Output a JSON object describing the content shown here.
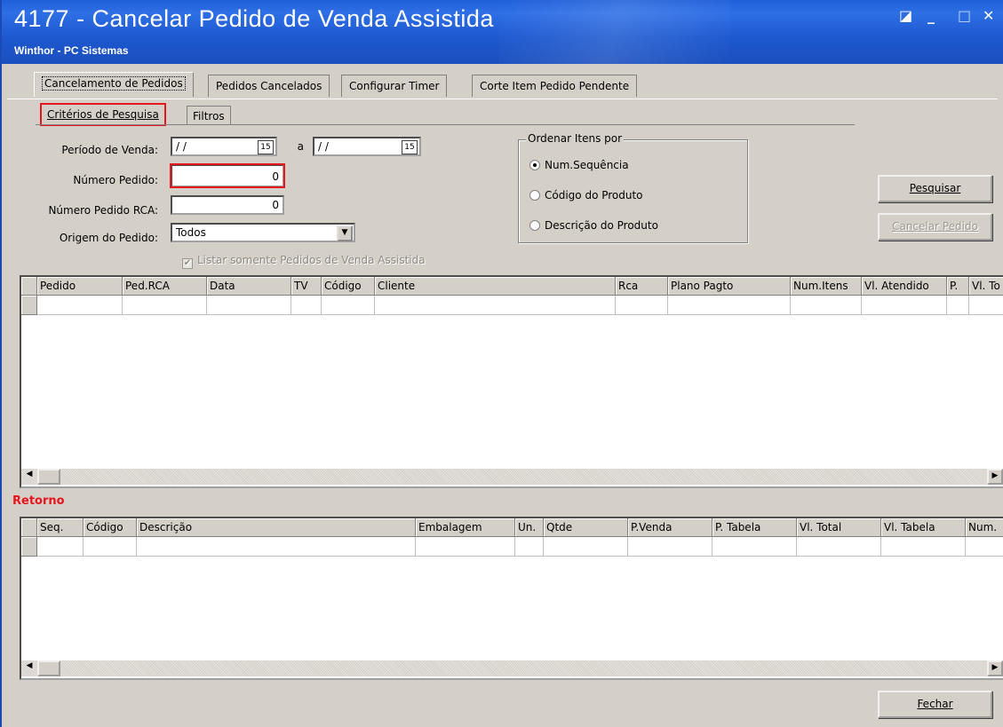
{
  "window": {
    "title": "4177 - Cancelar Pedido de Venda Assistida",
    "subtitle": "Winthor - PC Sistemas",
    "controls": {
      "restore": "◪",
      "minimize": "_",
      "maximize": "□",
      "close": "✕"
    }
  },
  "main_tabs": [
    {
      "label": "Cancelamento de Pedidos",
      "active": true
    },
    {
      "label": "Pedidos Cancelados",
      "active": false
    },
    {
      "label": "Configurar Timer",
      "active": false
    },
    {
      "label": "Corte Item Pedido Pendente",
      "active": false
    }
  ],
  "sub_tabs": [
    {
      "label": "Critérios de Pesquisa",
      "active": true
    },
    {
      "label": "Filtros",
      "active": false
    }
  ],
  "form": {
    "periodo_label": "Período de Venda:",
    "periodo_start": "/ /",
    "periodo_sep": "a",
    "periodo_end": "/ /",
    "calendar_icon": "15",
    "numero_pedido_label": "Número Pedido:",
    "numero_pedido_value": "0",
    "numero_rca_label": "Número Pedido RCA:",
    "numero_rca_value": "0",
    "origem_label": "Origem do Pedido:",
    "origem_value": "Todos",
    "listar_check_label": "Listar somente Pedidos de Venda Assistida",
    "listar_checked": true
  },
  "ordenar": {
    "legend": "Ordenar Itens por",
    "options": [
      {
        "label": "Num.Sequência",
        "selected": true
      },
      {
        "label": "Código do Produto",
        "selected": false
      },
      {
        "label": "Descrição do Produto",
        "selected": false
      }
    ]
  },
  "buttons": {
    "pesquisar": "Pesquisar",
    "cancelar_pedido": "Cancelar Pedido",
    "fechar": "Fechar"
  },
  "pedidos_grid": {
    "columns": [
      "Pedido",
      "Ped.RCA",
      "Data",
      "TV",
      "Código",
      "Cliente",
      "Rca",
      "Plano Pagto",
      "Num.Itens",
      "Vl. Atendido",
      "P.",
      "Vl. To"
    ]
  },
  "retorno_label": "Retorno",
  "itens_grid": {
    "columns": [
      "Seq.",
      "Código",
      "Descrição",
      "Embalagem",
      "Un.",
      "Qtde",
      "P.Venda",
      "P. Tabela",
      "Vl. Total",
      "Vl. Tabela",
      "Num."
    ]
  },
  "scroll_arrows": {
    "left": "◀",
    "right": "▶"
  }
}
